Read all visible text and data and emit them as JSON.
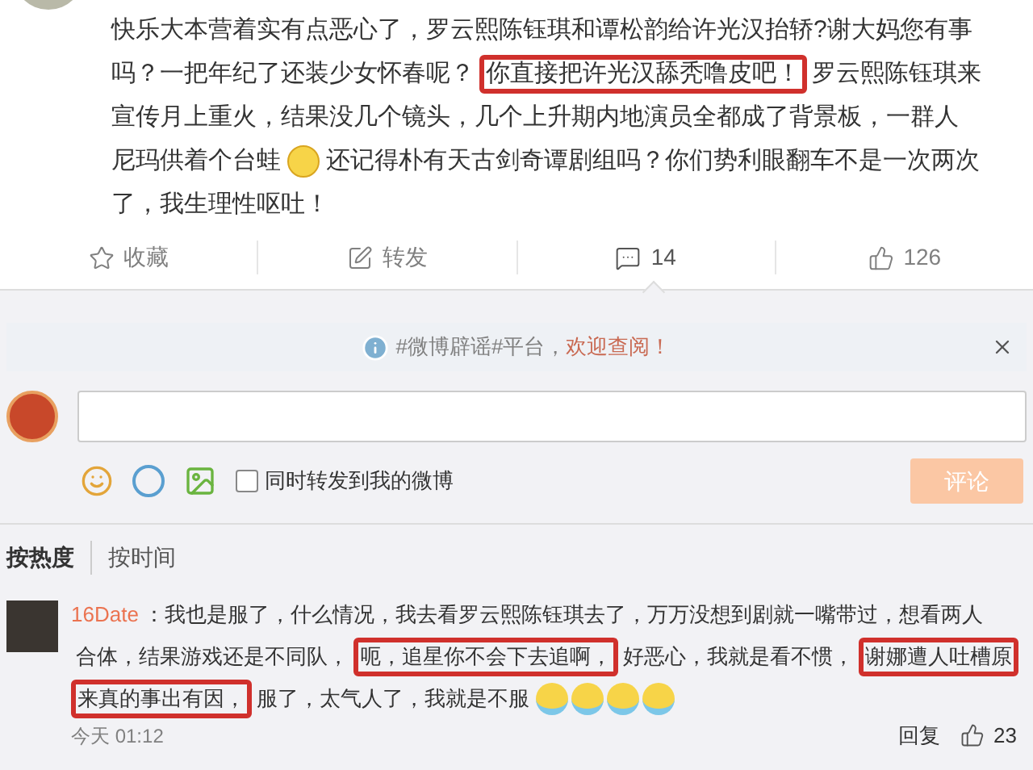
{
  "post": {
    "lines": [
      [
        {
          "kind": "text",
          "text": "快乐大本营着实有点恶心了，罗云熙陈钰琪和谭松韵给许光汉抬轿?谢大妈您有事",
          "boxed": false
        }
      ],
      [
        {
          "kind": "text",
          "text": "吗？一把年纪了还装少女怀春呢？",
          "boxed": false
        },
        {
          "kind": "text",
          "text": "你直接把许光汉舔秃噜皮吧！",
          "boxed": true
        },
        {
          "kind": "text",
          "text": "罗云熙陈钰琪来",
          "boxed": false
        }
      ],
      [
        {
          "kind": "text",
          "text": "宣传月上重火，结果没几个镜头，几个上升期内地演员全都成了背景板，一群人",
          "boxed": false
        }
      ],
      [
        {
          "kind": "text",
          "text": "尼玛供着个台蛙",
          "boxed": false
        },
        {
          "kind": "emoji"
        },
        {
          "kind": "text",
          "text": "还记得朴有天古剑奇谭剧组吗？你们势利眼翻车不是一次两次",
          "boxed": false
        }
      ],
      [
        {
          "kind": "text",
          "text": "了，我生理性呕吐！",
          "boxed": false
        }
      ]
    ]
  },
  "actions": [
    {
      "kind": "star",
      "label": "收藏",
      "selected": false
    },
    {
      "kind": "share",
      "label": "转发",
      "selected": false
    },
    {
      "kind": "comment",
      "label": "14",
      "selected": true
    },
    {
      "kind": "like",
      "label": "126",
      "selected": false
    }
  ],
  "notice": {
    "text": "#微博辟谣#平台，",
    "link": "欢迎查阅！"
  },
  "composer": {
    "also_repost": {
      "label": "同时转发到我的微博",
      "checked": false
    },
    "submit": {
      "label": "评论",
      "disabled": true
    }
  },
  "sort_tabs": [
    {
      "label": "按热度",
      "selected": true
    },
    {
      "label": "按时间",
      "selected": false
    }
  ],
  "comments": [
    {
      "user": "16Date",
      "lines": [
        [
          {
            "kind": "text",
            "text": "：我也是服了，什么情况，我去看罗云熙陈钰琪去了，万万没想到剧就一嘴带过，想看两人",
            "boxed": false
          }
        ],
        [
          {
            "kind": "text",
            "text": "合体，结果游戏还是不同队，",
            "boxed": false
          },
          {
            "kind": "text",
            "text": "呃，追星你不会下去追啊，",
            "boxed": true
          },
          {
            "kind": "text",
            "text": "好恶心，我就是看不惯，",
            "boxed": false
          },
          {
            "kind": "text",
            "text": "谢娜遭人吐槽原",
            "boxed": true
          }
        ],
        [
          {
            "kind": "text",
            "text": "来真的事出有因，",
            "boxed": true
          },
          {
            "kind": "text",
            "text": "服了，太气人了，我就是不服",
            "boxed": false
          },
          {
            "kind": "tears"
          },
          {
            "kind": "tears"
          },
          {
            "kind": "tears"
          },
          {
            "kind": "tears"
          }
        ]
      ],
      "time": "今天 01:12",
      "reply": "回复",
      "likes": "23"
    }
  ]
}
